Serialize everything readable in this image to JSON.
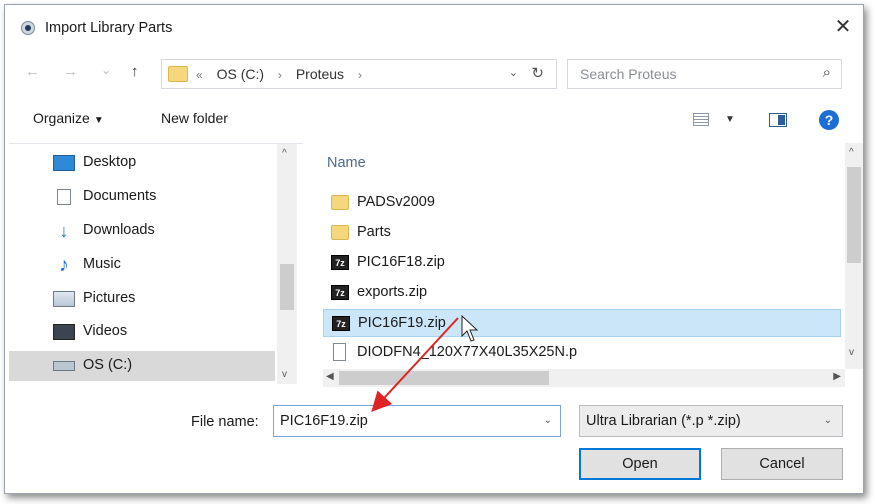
{
  "window": {
    "title": "Import Library Parts",
    "close_glyph": "✕"
  },
  "nav": {
    "back_glyph": "←",
    "forward_glyph": "→",
    "recent_glyph": "⌄",
    "up_glyph": "↑",
    "address": {
      "prefix": "«",
      "crumbs": [
        "OS (C:)",
        "Proteus"
      ],
      "sep": "›",
      "dropdown_glyph": "⌄",
      "refresh_glyph": "↻"
    },
    "search": {
      "placeholder": "Search Proteus",
      "icon_glyph": "⌕"
    }
  },
  "toolbar": {
    "organize_label": "Organize",
    "organize_caret": "▼",
    "new_folder_label": "New folder",
    "view_caret": "▼",
    "help_glyph": "?"
  },
  "sidebar": {
    "items": [
      {
        "label": "Desktop",
        "icon": "desktop-icon"
      },
      {
        "label": "Documents",
        "icon": "documents-icon"
      },
      {
        "label": "Downloads",
        "icon": "downloads-icon"
      },
      {
        "label": "Music",
        "icon": "music-icon"
      },
      {
        "label": "Pictures",
        "icon": "pictures-icon"
      },
      {
        "label": "Videos",
        "icon": "videos-icon"
      },
      {
        "label": "OS (C:)",
        "icon": "drive-icon",
        "selected": true
      }
    ],
    "down_arrow_glyph": "↓",
    "music_glyph": "♪"
  },
  "files": {
    "column_name": "Name",
    "items": [
      {
        "name": "PADSv2009",
        "type": "folder"
      },
      {
        "name": "Parts",
        "type": "folder"
      },
      {
        "name": "PIC16F18.zip",
        "type": "7z"
      },
      {
        "name": "exports.zip",
        "type": "7z"
      },
      {
        "name": "PIC16F19.zip",
        "type": "7z",
        "selected": true
      },
      {
        "name": "DIODFN4_120X77X40L35X25N.p",
        "type": "file"
      }
    ],
    "archive_badge": "7z"
  },
  "scroll": {
    "up": "▲",
    "down": "▼",
    "left": "◀",
    "right": "▶",
    "chev_up": "^",
    "chev_down": "v"
  },
  "footer": {
    "file_name_label": "File name:",
    "file_name_value": "PIC16F19.zip",
    "file_name_dropdown": "⌄",
    "type_value": "Ultra Librarian (*.p *.zip)",
    "type_dropdown": "⌄",
    "open_label": "Open",
    "cancel_label": "Cancel"
  },
  "colors": {
    "accent": "#0078d7",
    "selection": "#cce6f9",
    "annotation_arrow": "#e02424"
  }
}
